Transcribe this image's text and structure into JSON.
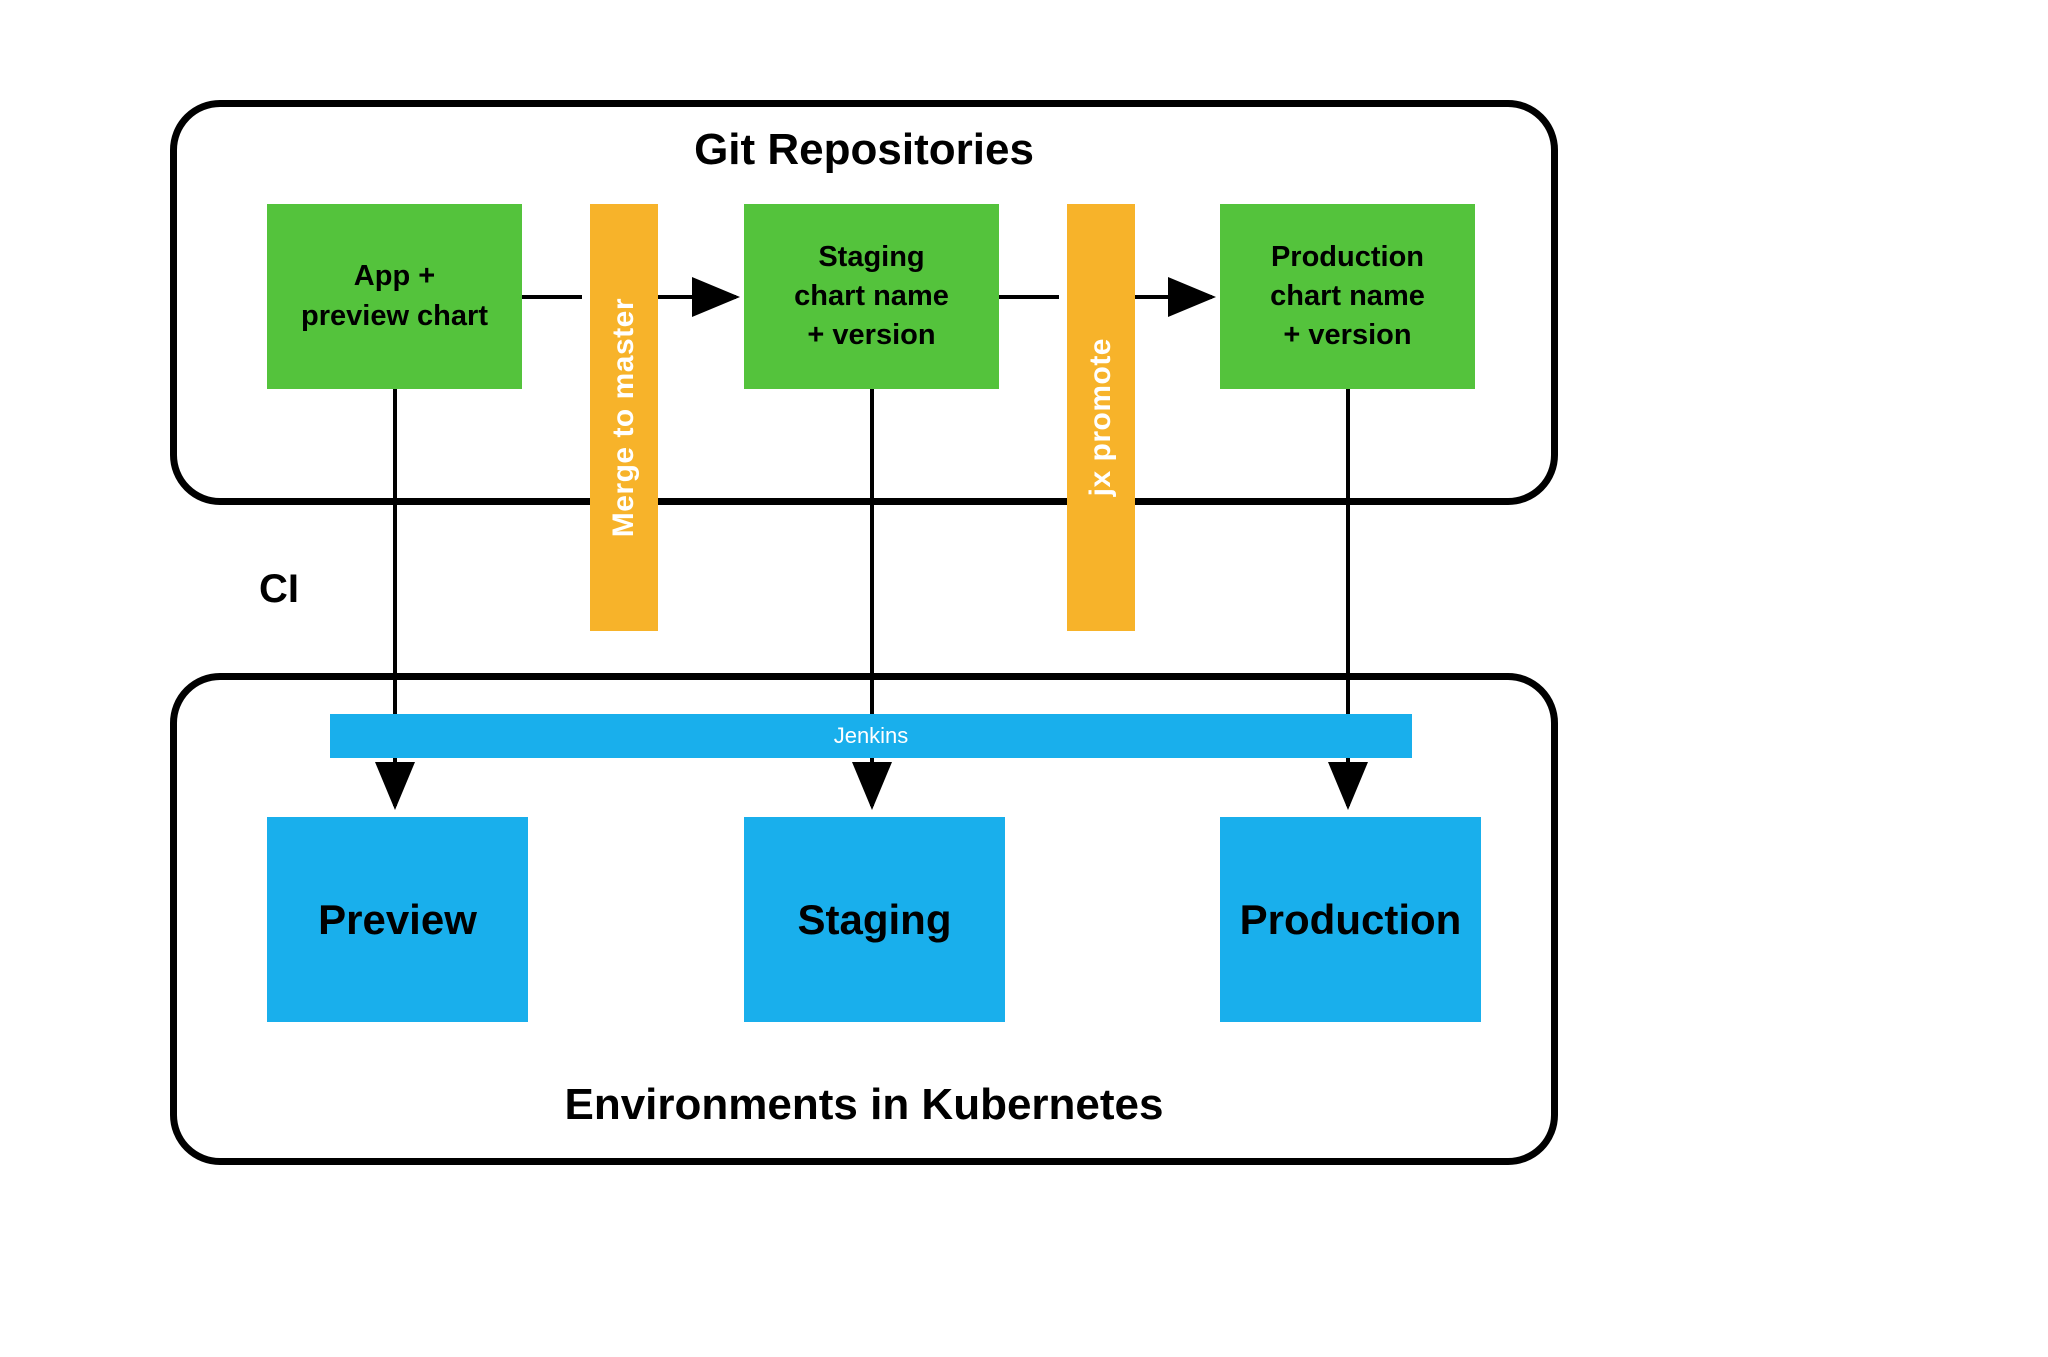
{
  "diagram": {
    "top_panel_title": "Git Repositories",
    "bottom_panel_title": "Environments in Kubernetes",
    "ci_label": "CI",
    "jenkins_label": "Jenkins",
    "repos": {
      "app": "App +\npreview chart",
      "staging": "Staging\nchart name\n+ version",
      "production": "Production\nchart name\n+ version"
    },
    "transitions": {
      "merge": "Merge to master",
      "promote": "jx promote"
    },
    "environments": {
      "preview": "Preview",
      "staging": "Staging",
      "production": "Production"
    }
  },
  "colors": {
    "green": "#54c33c",
    "orange": "#f7b32a",
    "blue": "#19afec",
    "black": "#000000"
  }
}
